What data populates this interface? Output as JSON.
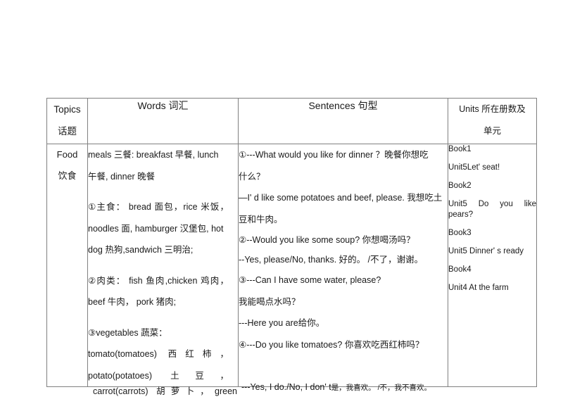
{
  "table": {
    "headers": {
      "topics_en": "Topics",
      "topics_zh": "话题",
      "words": "Words 词汇",
      "sentences": "Sentences 句型",
      "units_line1": "Units 所在册数及",
      "units_line2": "单元"
    },
    "row": {
      "topic_en": "Food",
      "topic_zh": "饮食",
      "words_lines": [
        "meals 三餐: breakfast 早餐, lunch",
        "午餐, dinner 晚餐",
        "①主食： bread 面包，rice 米饭，",
        "noodles 面, hamburger 汉堡包, hot",
        "dog 热狗,sandwich 三明治;",
        "②肉类： fish 鱼肉,chicken 鸡肉，",
        "beef 牛肉， pork 猪肉;",
        "③vegetables 蔬菜：",
        "tomato(tomatoes) 西红柿，",
        "potato(potatoes) 土豆，",
        "carrot(carrots) 胡萝卜，green"
      ],
      "sentence_lines": [
        "①---What would you like for dinner ？晚餐你想吃",
        "什么？",
        "—I' d like some potatoes and beef, please. 我想吃土",
        "豆和牛肉。",
        "②--Would you like some soup? 你想喝汤吗？",
        "--Yes, please/No, thanks. 好的。 /不了，谢谢。",
        "③---Can I have some water, please?",
        "我能喝点水吗？",
        "---Here you are给你。",
        "④---Do you like tomatoes? 你喜欢吃西红柿吗？"
      ],
      "sentence_overflow_main": "---Yes, I do./No, I don' t",
      "sentence_overflow_small": "是，我喜欢。 /不，我不喜欢。",
      "units_lines": [
        "Book1",
        "Unit5Let' seat!",
        "Book2",
        "Unit5 Do you like pears?",
        "Book3",
        "Unit5 Dinner' s ready",
        "Book4",
        "Unit4 At the farm"
      ]
    }
  },
  "colors": {
    "border": "#808080",
    "text": "#1a1a1a",
    "background": "#ffffff"
  }
}
